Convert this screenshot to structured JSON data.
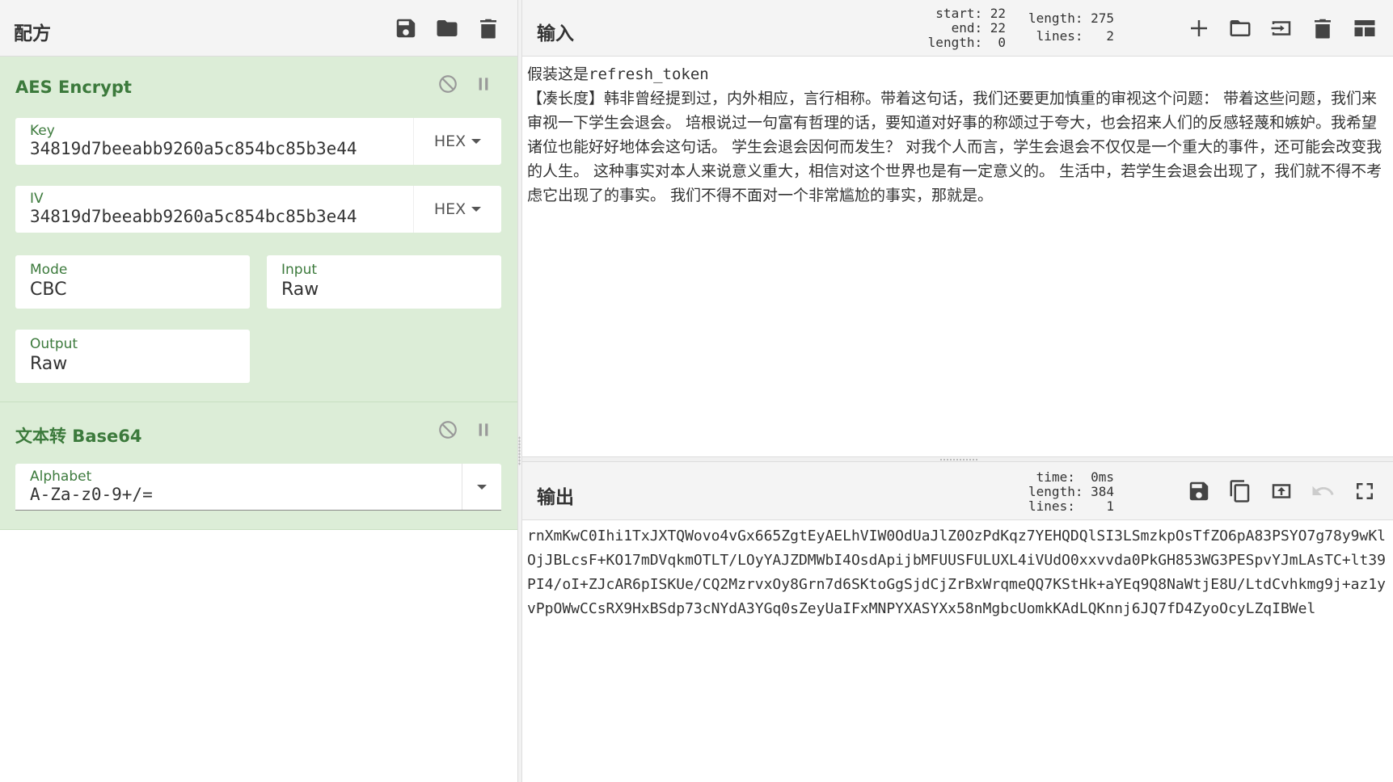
{
  "recipe": {
    "title": "配方",
    "icons": [
      "save-icon",
      "folder-icon",
      "trash-icon"
    ]
  },
  "aes": {
    "title": "AES Encrypt",
    "key_label": "Key",
    "key_value": "34819d7beeabb9260a5c854bc85b3e44",
    "key_format": "HEX",
    "iv_label": "IV",
    "iv_value": "34819d7beeabb9260a5c854bc85b3e44",
    "iv_format": "HEX",
    "mode_label": "Mode",
    "mode_value": "CBC",
    "input_label": "Input",
    "input_value": "Raw",
    "output_label": "Output",
    "output_value": "Raw"
  },
  "b64": {
    "title": "文本转 Base64",
    "alphabet_label": "Alphabet",
    "alphabet_value": "A-Za-z0-9+/="
  },
  "input": {
    "title": "输入",
    "start": "start: 22",
    "end": "end: 22",
    "sel_length": "length:  0",
    "length": "length: 275",
    "lines": "lines:   2",
    "line1_cn": "假装这是",
    "line1_mono": "refresh_token",
    "body": "【凑长度】韩非曾经提到过，内外相应，言行相称。带着这句话，我们还要更加慎重的审视这个问题： 带着这些问题，我们来审视一下学生会退会。 培根说过一句富有哲理的话，要知道对好事的称颂过于夸大，也会招来人们的反感轻蔑和嫉妒。我希望诸位也能好好地体会这句话。 学生会退会因何而发生？ 对我个人而言，学生会退会不仅仅是一个重大的事件，还可能会改变我的人生。 这种事实对本人来说意义重大，相信对这个世界也是有一定意义的。 生活中，若学生会退会出现了，我们就不得不考虑它出现了的事实。 我们不得不面对一个非常尴尬的事实，那就是。"
  },
  "output": {
    "title": "输出",
    "time": "time:  0ms",
    "length": "length: 384",
    "lines": "lines:    1",
    "text": "rnXmKwC0Ihi1TxJXTQWovo4vGx665ZgtEyAELhVIW0OdUaJlZ0OzPdKqz7YEHQDQlSI3LSmzkpOsTfZO6pA83PSYO7g78y9wKlOjJBLcsF+KO17mDVqkmOTLT/LOyYAJZDMWbI4OsdApijbMFUUSFULUXL4iVUdO0xxvvda0PkGH853WG3PESpvYJmLAsTC+lt39PI4/oI+ZJcAR6pISKUe/CQ2MzrvxOy8Grn7d6SKtoGgSjdCjZrBxWrqmeQQ7KStHk+aYEq9Q8NaWtjE8U/LtdCvhkmg9j+az1yvPpOWwCCsRX9HxBSdp73cNYdA3YGq0sZeyUaIFxMNPYXASYXx58nMgbcUomkKAdLQKnnj6JQ7fD4ZyoOcyLZqIBWel"
  }
}
